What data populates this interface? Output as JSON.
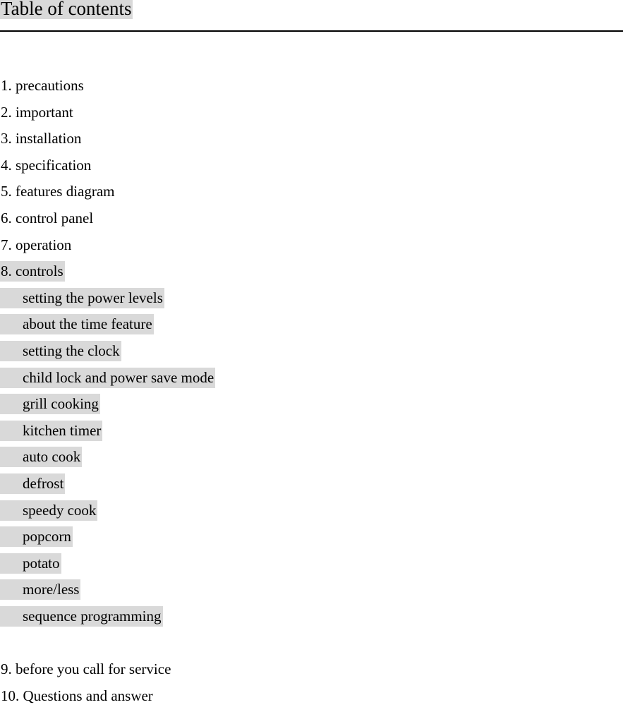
{
  "document": {
    "title": "Table of contents",
    "title_highlighted": true,
    "highlight_color": "#d9d9d9",
    "text_color": "#000000",
    "background_color": "#ffffff"
  },
  "divider": {
    "present": true,
    "color": "#000000"
  },
  "toc": {
    "entries": [
      {
        "label": "1. precautions",
        "level": "top",
        "highlighted": false
      },
      {
        "label": "2. important",
        "level": "top",
        "highlighted": false
      },
      {
        "label": "3. installation",
        "level": "top",
        "highlighted": false
      },
      {
        "label": "4. specification",
        "level": "top",
        "highlighted": false
      },
      {
        "label": "5. features diagram",
        "level": "top",
        "highlighted": false
      },
      {
        "label": "6. control panel",
        "level": "top",
        "highlighted": false
      },
      {
        "label": "7. operation",
        "level": "top",
        "highlighted": false
      },
      {
        "label": "8. controls",
        "level": "top",
        "highlighted": true
      },
      {
        "label": "setting the power levels",
        "level": "sub",
        "highlighted": true
      },
      {
        "label": "about the time feature",
        "level": "sub",
        "highlighted": true
      },
      {
        "label": "setting the clock",
        "level": "sub",
        "highlighted": true
      },
      {
        "label": "child lock and power save mode",
        "level": "sub",
        "highlighted": true
      },
      {
        "label": "grill cooking",
        "level": "sub",
        "highlighted": true
      },
      {
        "label": "kitchen timer",
        "level": "sub",
        "highlighted": true
      },
      {
        "label": "auto cook",
        "level": "sub",
        "highlighted": true
      },
      {
        "label": "defrost",
        "level": "sub",
        "highlighted": true
      },
      {
        "label": "speedy cook",
        "level": "sub",
        "highlighted": true
      },
      {
        "label": "popcorn",
        "level": "sub",
        "highlighted": true
      },
      {
        "label": "potato",
        "level": "sub",
        "highlighted": true
      },
      {
        "label": "more/less",
        "level": "sub",
        "highlighted": true
      },
      {
        "label": "sequence programming",
        "level": "sub",
        "highlighted": true
      },
      {
        "label": "",
        "level": "spacer",
        "highlighted": false
      },
      {
        "label": "9. before you call for service",
        "level": "top",
        "highlighted": false
      },
      {
        "label": "10. Questions and answer",
        "level": "top",
        "highlighted": false
      }
    ]
  }
}
